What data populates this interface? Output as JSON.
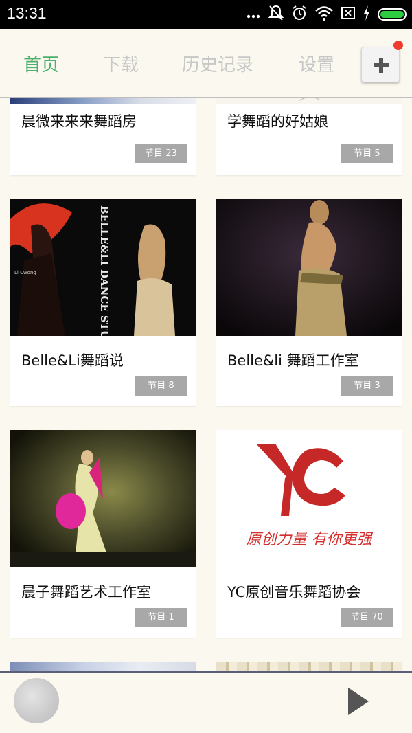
{
  "status_bar": {
    "time": "13:31",
    "icons": [
      "more-dots-icon",
      "mute-icon",
      "alarm-icon",
      "wifi-icon",
      "no-sim-icon",
      "charging-icon",
      "battery-icon"
    ]
  },
  "nav": {
    "tabs": [
      {
        "label": "首页",
        "active": true
      },
      {
        "label": "下载",
        "active": false
      },
      {
        "label": "历史记录",
        "active": false
      },
      {
        "label": "设置",
        "active": false
      }
    ],
    "add_button_icon": "plus-icon",
    "notification_dot_color": "#ef3b2f",
    "active_color": "#4caf6a"
  },
  "cards": [
    {
      "title": "晨微来来来舞蹈房",
      "badge": "节目 23",
      "image": "dance-photo"
    },
    {
      "title": "学舞蹈的好姑娘",
      "badge": "节目 5",
      "image": "dance-photo"
    },
    {
      "title": "Belle&Li舞蹈说",
      "badge": "节目 8",
      "image": "belle-li-dance-studio-poster",
      "image_text": [
        "BELLE&LI DANCE STUD",
        "Li Cwong"
      ]
    },
    {
      "title": "Belle&li 舞蹈工作室",
      "badge": "节目 3",
      "image": "belly-dancer-photo"
    },
    {
      "title": "晨子舞蹈艺术工作室",
      "badge": "节目 1",
      "image": "fan-dancer-photo"
    },
    {
      "title": "YC原创音乐舞蹈协会",
      "badge": "节目 70",
      "image": "yc-logo",
      "image_text": [
        "原创力量 有你更强"
      ]
    }
  ],
  "player": {
    "disc_icon": "album-disc-icon",
    "play_icon": "play-icon"
  }
}
